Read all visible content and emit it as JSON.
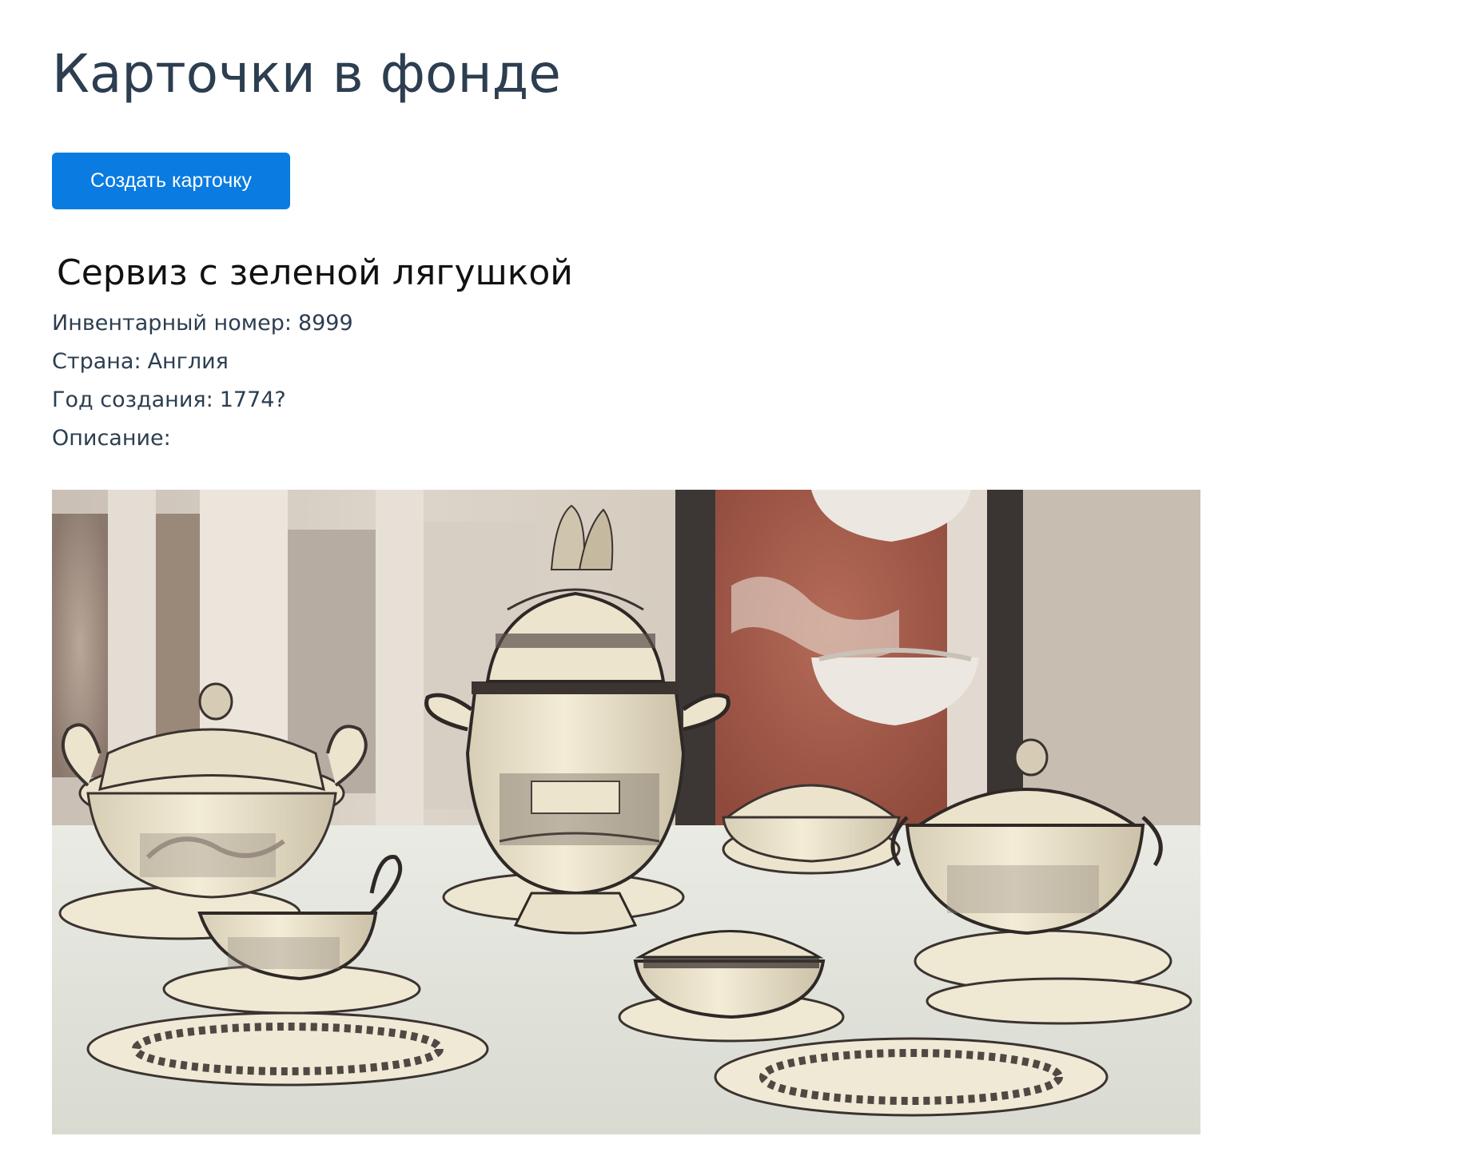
{
  "page": {
    "title": "Карточки в фонде"
  },
  "toolbar": {
    "create_label": "Создать карточку",
    "create_color": "#0a7be0"
  },
  "card": {
    "title": "Сервиз с зеленой лягушкой",
    "fields": [
      {
        "label": "Инвентарный номер:",
        "value": "8999"
      },
      {
        "label": "Страна:",
        "value": "Англия"
      },
      {
        "label": "Год создания:",
        "value": "1774?"
      },
      {
        "label": "Описание:",
        "value": ""
      }
    ]
  }
}
